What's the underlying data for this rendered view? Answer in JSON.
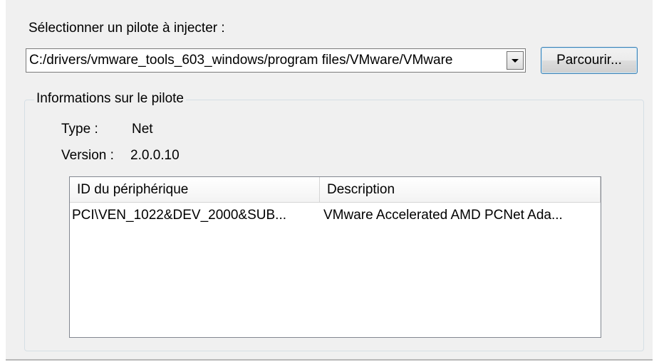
{
  "driver_selection": {
    "label": "Sélectionner un pilote à injecter :",
    "path_value": "C:/drivers/vmware_tools_603_windows/program files/VMware/VMware",
    "browse_label": "Parcourir..."
  },
  "driver_info": {
    "group_title": "Informations sur le pilote",
    "type_label": "Type :",
    "type_value": "Net",
    "version_label": "Version :",
    "version_value": "2.0.0.10"
  },
  "device_table": {
    "columns": [
      "ID du périphérique",
      "Description"
    ],
    "rows": [
      [
        "PCI\\VEN_1022&DEV_2000&SUB...",
        "VMware Accelerated AMD PCNet Ada..."
      ]
    ]
  }
}
